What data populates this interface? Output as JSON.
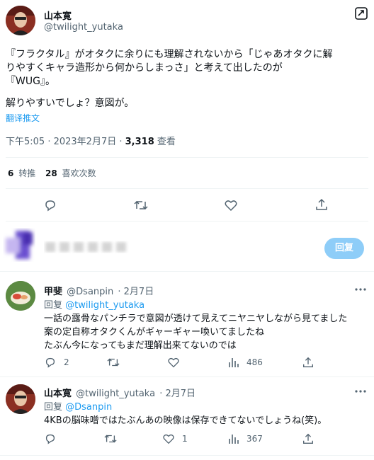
{
  "main_tweet": {
    "author_name": "山本寛",
    "author_handle": "@twilight_yutaka",
    "line1": "『フラクタル』がオタクに余りにも理解されないから「じゃあオタクに解",
    "line2": "りやすくキャラ造形から何からしまっさ」と考えて出したのが",
    "line3": "『WUG』。",
    "line4": "解りやすいでしょ？意図が。",
    "translate": "翻译推文",
    "meta_time": "下午5:05 · 2023年2月7日 · ",
    "meta_views_count": "3,318",
    "meta_views_label": " 查看",
    "retweets_count": "6",
    "retweets_label": "转推",
    "likes_count": "28",
    "likes_label": "喜欢次数"
  },
  "composer": {
    "reply_button": "回复"
  },
  "replies": [
    {
      "author_name": "甲斐",
      "author_handle": "@Dsanpin",
      "date": "· 2月7日",
      "reply_prefix": "回复 ",
      "reply_to": "@twilight_yutaka",
      "line1": "一話の露骨なパンチラで意図が透けて見えてニヤニヤしながら見てました",
      "line2": "案の定自称オタクくんがギャーギャー喚いてましたね",
      "line3": "たぶん今になってもまだ理解出来てないのでは",
      "reply_count": "2",
      "retweet_count": "",
      "like_count": "",
      "views_count": "486"
    },
    {
      "author_name": "山本寛",
      "author_handle": "@twilight_yutaka",
      "date": "· 2月7日",
      "reply_prefix": "回复 ",
      "reply_to": "@Dsanpin",
      "line1": "4KBの脳味噌ではたぶんあの映像は保存できてないでしょうね(笑)。",
      "reply_count": "",
      "retweet_count": "",
      "like_count": "1",
      "views_count": "367"
    }
  ],
  "colors": {
    "accent": "#1d9bf0",
    "reply_button_disabled": "#8ecdf8",
    "text_secondary": "#536471",
    "divider": "#eff3f4"
  },
  "icons": [
    "grok-icon",
    "reply-icon",
    "retweet-icon",
    "like-icon",
    "share-icon",
    "views-icon",
    "more-icon"
  ]
}
